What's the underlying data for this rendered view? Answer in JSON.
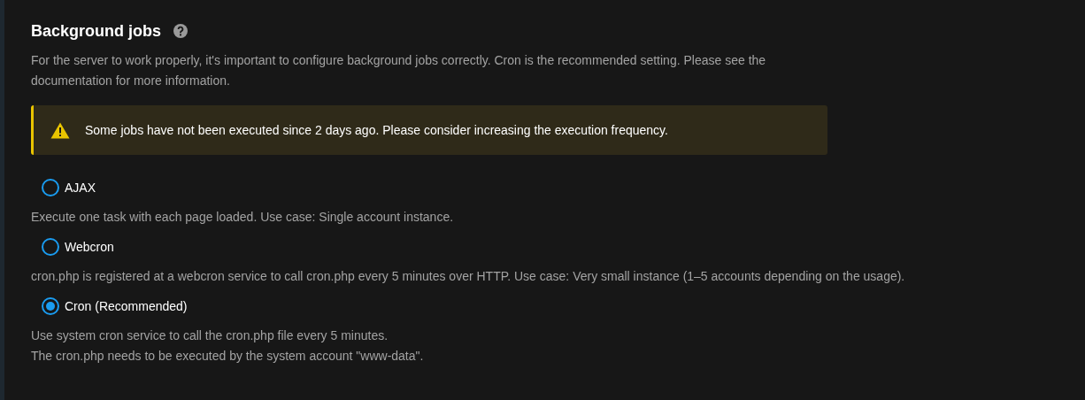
{
  "section": {
    "title": "Background jobs",
    "description": "For the server to work properly, it's important to configure background jobs correctly. Cron is the recommended setting. Please see the documentation for more information."
  },
  "warning": {
    "kind": "warning",
    "text": "Some jobs have not been executed since 2 days ago. Please consider increasing the execution frequency."
  },
  "options": [
    {
      "label": "AJAX",
      "selected": false,
      "description": [
        "Execute one task with each page loaded. Use case: Single account instance."
      ]
    },
    {
      "label": "Webcron",
      "selected": false,
      "description": [
        "cron.php is registered at a webcron service to call cron.php every 5 minutes over HTTP. Use case: Very small instance (1–5 accounts depending on the usage)."
      ]
    },
    {
      "label": "Cron (Recommended)",
      "selected": true,
      "description": [
        "Use system cron service to call the cron.php file every 5 minutes.",
        "The cron.php needs to be executed by the system account \"www-data\"."
      ]
    }
  ]
}
